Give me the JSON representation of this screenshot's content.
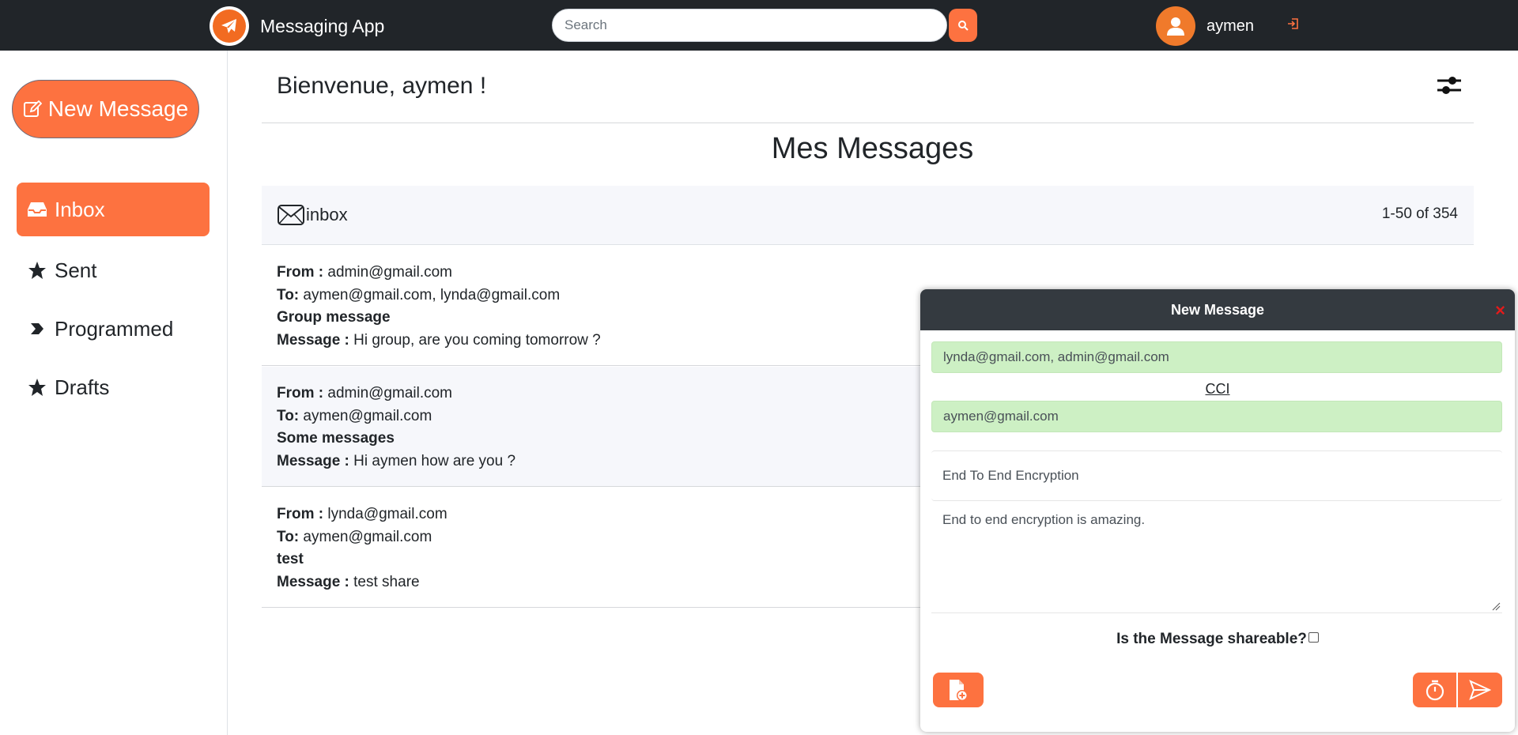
{
  "header": {
    "app_name": "Messaging App",
    "search_placeholder": "Search",
    "username": "aymen"
  },
  "sidebar": {
    "new_message_label": "New Message",
    "items": [
      {
        "label": "Inbox",
        "icon": "inbox-icon",
        "active": true
      },
      {
        "label": "Sent",
        "icon": "star-icon",
        "active": false
      },
      {
        "label": "Programmed",
        "icon": "tag-arrow-icon",
        "active": false
      },
      {
        "label": "Drafts",
        "icon": "star-icon",
        "active": false
      }
    ]
  },
  "main": {
    "welcome": "Bienvenue, aymen !",
    "title": "Mes Messages",
    "folder_label": "inbox",
    "pagination": "1-50 of 354",
    "labels": {
      "from": "From :",
      "to": "To:",
      "message": "Message :"
    },
    "messages": [
      {
        "from": "admin@gmail.com",
        "to": "aymen@gmail.com, lynda@gmail.com",
        "subject": "Group message",
        "body": "Hi group, are you coming tomorrow ?"
      },
      {
        "from": "admin@gmail.com",
        "to": "aymen@gmail.com",
        "subject": "Some messages",
        "body": "Hi aymen how are you ?"
      },
      {
        "from": "lynda@gmail.com",
        "to": "aymen@gmail.com",
        "subject": "test",
        "body": "test share"
      }
    ]
  },
  "compose": {
    "title": "New Message",
    "close": "×",
    "to": "lynda@gmail.com, admin@gmail.com",
    "cci_label": "CCI",
    "cci": "aymen@gmail.com",
    "subject": "End To End Encryption",
    "body": "End to end encryption is amazing.",
    "shareable_label": "Is the Message shareable?",
    "shareable": false
  },
  "colors": {
    "accent": "#fd7240",
    "navbar": "#212529",
    "compose_header": "#343a40",
    "field_green": "#cdf0c4",
    "close_red": "#e31b1b"
  }
}
